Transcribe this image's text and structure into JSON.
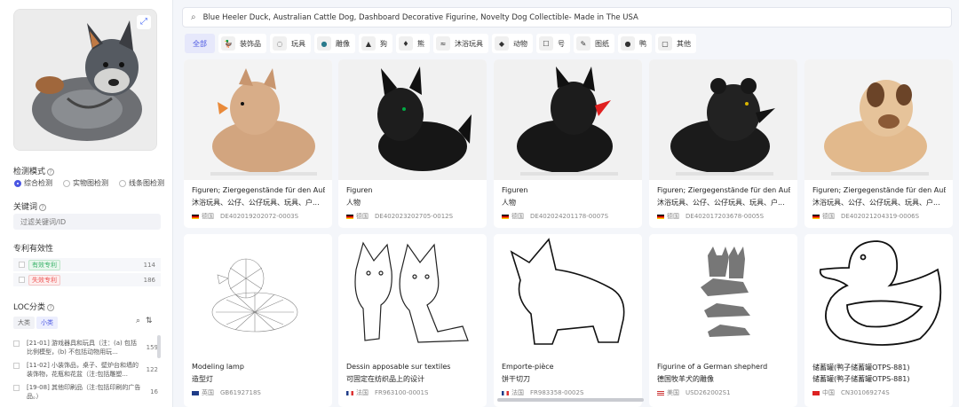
{
  "search": {
    "query": "Blue Heeler Duck, Australian Cattle Dog, Dashboard Decorative Figurine, Novelty Dog Collectible- Made in The USA"
  },
  "left": {
    "detect_mode_label": "检测模式",
    "modes": [
      "综合检测",
      "实物图检测",
      "线条图检测"
    ],
    "keyword_label": "关键词",
    "keyword_placeholder": "过滤关键词/ID",
    "validity_label": "专利有效性",
    "validity": [
      {
        "label": "有效专利",
        "count": "114"
      },
      {
        "label": "失效专利",
        "count": "186"
      }
    ],
    "loc_label": "LOC分类",
    "loc_tabs": [
      "大类",
      "小类"
    ],
    "loc_items": [
      {
        "text": "[21-01] 游戏器具和玩具（注：(a) 包括比例模型，(b) 不包括动物用玩...",
        "count": "159"
      },
      {
        "text": "[11-02] 小装饰品，桌子、壁炉台和墙的装饰物，花瓶和花盆（注:包括雕塑...",
        "count": "122"
      },
      {
        "text": "[19-08] 其他印刷品（注:包括印刷的广告品。）",
        "count": "16"
      }
    ]
  },
  "categories": [
    "全部",
    "装饰品",
    "玩具",
    "雕像",
    "狗",
    "熊",
    "沐浴玩具",
    "动物",
    "号",
    "图纸",
    "鸭",
    "其他"
  ],
  "cards": [
    {
      "title": "Figuren; Ziergegenstände für den Auß...",
      "sub": "沐浴玩具、公仔、公仔玩具、玩具、户...",
      "country": "德国",
      "id": "DE402019202072-0003S",
      "flag": "de"
    },
    {
      "title": "Figuren",
      "sub": "人物",
      "country": "德国",
      "id": "DE402023202705-0012S",
      "flag": "de"
    },
    {
      "title": "Figuren",
      "sub": "人物",
      "country": "德国",
      "id": "DE402024201178-0007S",
      "flag": "de"
    },
    {
      "title": "Figuren; Ziergegenstände für den Auß...",
      "sub": "沐浴玩具、公仔、公仔玩具、玩具、户...",
      "country": "德国",
      "id": "DE402017203678-0005S",
      "flag": "de"
    },
    {
      "title": "Figuren; Ziergegenstände für den Auß...",
      "sub": "沐浴玩具、公仔、公仔玩具、玩具、户...",
      "country": "德国",
      "id": "DE402021204319-0006S",
      "flag": "de"
    },
    {
      "title": "Modeling lamp",
      "sub": "造型灯",
      "country": "英国",
      "id": "GB6192718S",
      "flag": "uk"
    },
    {
      "title": "Dessin apposable sur textiles",
      "sub": "可固定在纺织品上的设计",
      "country": "法国",
      "id": "FR963100-0001S",
      "flag": "fr"
    },
    {
      "title": "Emporte-pièce",
      "sub": "饼干切刀",
      "country": "法国",
      "id": "FR983358-0002S",
      "flag": "fr"
    },
    {
      "title": "Figurine of a German shepherd",
      "sub": "德国牧羊犬的雕像",
      "country": "美国",
      "id": "USD262002S1",
      "flag": "us"
    },
    {
      "title": "储蓄罐(鸭子储蓄罐OTPS-881)",
      "sub": "储蓄罐(鸭子储蓄罐OTPS-881)",
      "country": "中国",
      "id": "CN301069274S",
      "flag": "cn"
    }
  ]
}
